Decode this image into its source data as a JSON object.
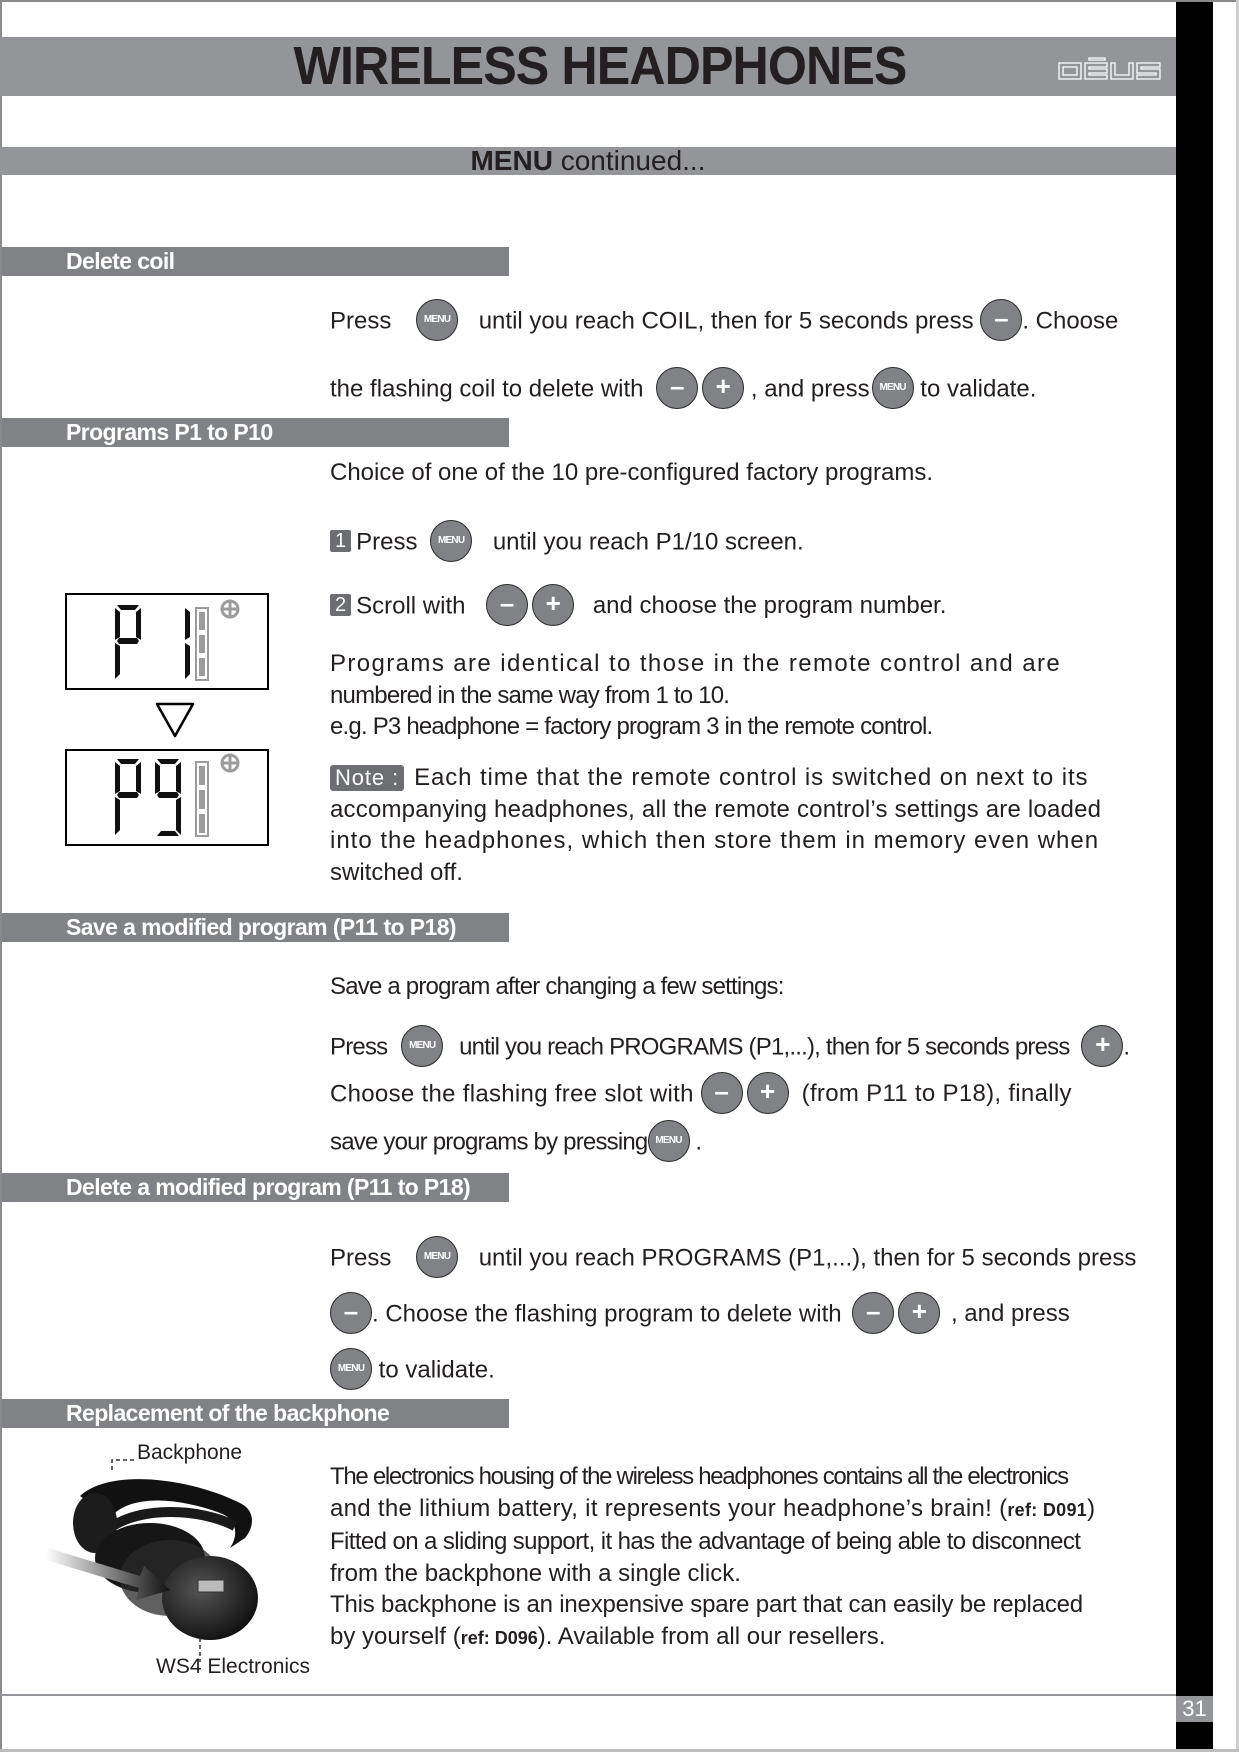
{
  "header": {
    "title": "WIRELESS HEADPHONES",
    "logo": "DĒUS",
    "subtitle_bold": "MENU",
    "subtitle_rest": " continued..."
  },
  "buttons": {
    "menu": "MENU",
    "minus": "–",
    "plus": "+"
  },
  "sections": {
    "delete_coil": {
      "title": "Delete coil",
      "line1": {
        "a": "Press",
        "b": "until you reach COIL, then for 5 seconds press",
        "c": ". Choose"
      },
      "line2": {
        "a": "the flashing coil to delete with",
        "b": ", and press",
        "c": "to validate."
      }
    },
    "programs": {
      "title": "Programs P1 to P10",
      "intro": "Choice of one of the 10 pre-configured factory programs.",
      "step1": {
        "num": "1",
        "a": "Press",
        "b": "until you reach P1/10 screen."
      },
      "step2": {
        "num": "2",
        "a": "Scroll with",
        "b": "and choose the program number."
      },
      "identical_1": "Programs are identical to those in the remote control and are",
      "identical_2": "numbered in the same way from 1 to 10.",
      "example": "e.g. P3 headphone = factory program 3 in the remote control.",
      "note_label": "Note :",
      "note_1": "Each time that the remote control is switched on next to its",
      "note_2": "accompanying headphones, all the remote control’s settings are loaded",
      "note_3": "into the headphones, which then store them in memory even when",
      "note_4": "switched off.",
      "lcd_top": "P1",
      "lcd_bottom": "P9"
    },
    "save_program": {
      "title": "Save a modified program (P11 to P18)",
      "intro": "Save a program after changing a few settings:",
      "line1": {
        "a": "Press",
        "b": "until you reach PROGRAMS (P1,...), then for 5 seconds press",
        "c": "."
      },
      "line2": {
        "a": "Choose the flashing free slot with",
        "b": "(from P11 to P18), finally"
      },
      "line3": {
        "a": "save your programs by pressing",
        "b": "."
      }
    },
    "delete_program": {
      "title": "Delete a modified program (P11 to P18)",
      "line1": {
        "a": "Press",
        "b": "until you reach PROGRAMS (P1,...), then for 5 seconds press"
      },
      "line2": {
        "a": ". Choose the flashing program to delete with",
        "b": ", and press"
      },
      "line3": {
        "a": "to validate."
      }
    },
    "backphone": {
      "title": "Replacement of the backphone",
      "caption_top": "Backphone",
      "caption_bottom": "WS4 Electronics",
      "p1": "The electronics housing of the wireless headphones contains all the electronics",
      "p2": "and the lithium battery, it represents your headphone’s brain! (",
      "p2_ref": "ref: D091",
      "p2_end": ")",
      "p3": "Fitted on a sliding support, it has the advantage of being able to disconnect",
      "p4": "from the backphone with a single click.",
      "p5": "This backphone is an inexpensive spare part that can easily be replaced",
      "p6": "by yourself (",
      "p6_ref": "ref: D096",
      "p6_end": "). Available from all our resellers."
    }
  },
  "footer": {
    "page_number": "31"
  }
}
